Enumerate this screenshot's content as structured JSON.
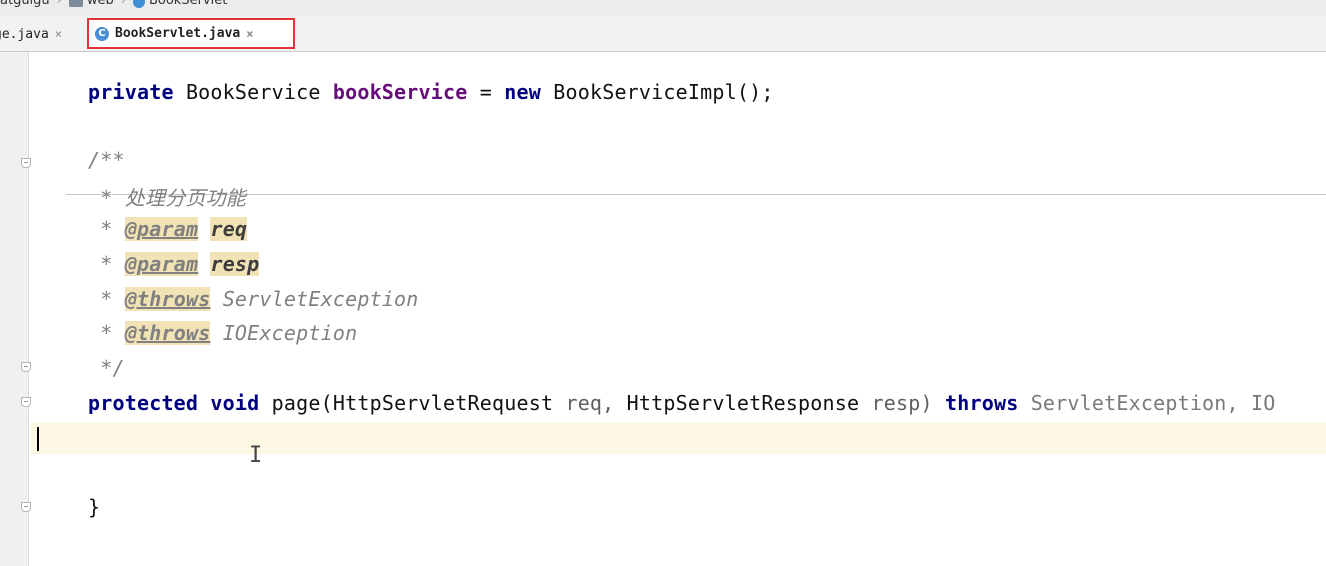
{
  "breadcrumb": {
    "items": [
      "atguigu",
      "web",
      "BookServlet"
    ]
  },
  "tabs": {
    "previous": "ge.java",
    "active": "BookServlet.java",
    "active_icon": "C",
    "close": "×"
  },
  "code": {
    "field_line": {
      "kw_private": "private",
      "type": "BookService",
      "name": "bookService",
      "eq": "=",
      "kw_new": "new",
      "ctor": "BookServiceImpl();"
    },
    "javadoc": {
      "open": "/**",
      "star": "*",
      "description": "处理分页功能",
      "tag_param": "@param",
      "tag_throws": "@throws",
      "param_req": "req",
      "param_resp": "resp",
      "exc_servlet": "ServletException",
      "exc_io": "IOException",
      "close": "*/"
    },
    "method_line": {
      "kw_protected": "protected",
      "kw_void": "void",
      "name": "page(",
      "req_type": "HttpServletRequest",
      "req_name": "req,",
      "resp_type": "HttpServletResponse",
      "resp_name": "resp)",
      "kw_throws": "throws",
      "exceptions": "ServletException, IO"
    },
    "closing_brace": "}",
    "ibeam": "I"
  },
  "colors": {
    "keyword": "#000080",
    "field": "#660e7a",
    "comment": "#808080",
    "tab_highlight": "#e0343a",
    "current_line": "#fdf8e3"
  }
}
